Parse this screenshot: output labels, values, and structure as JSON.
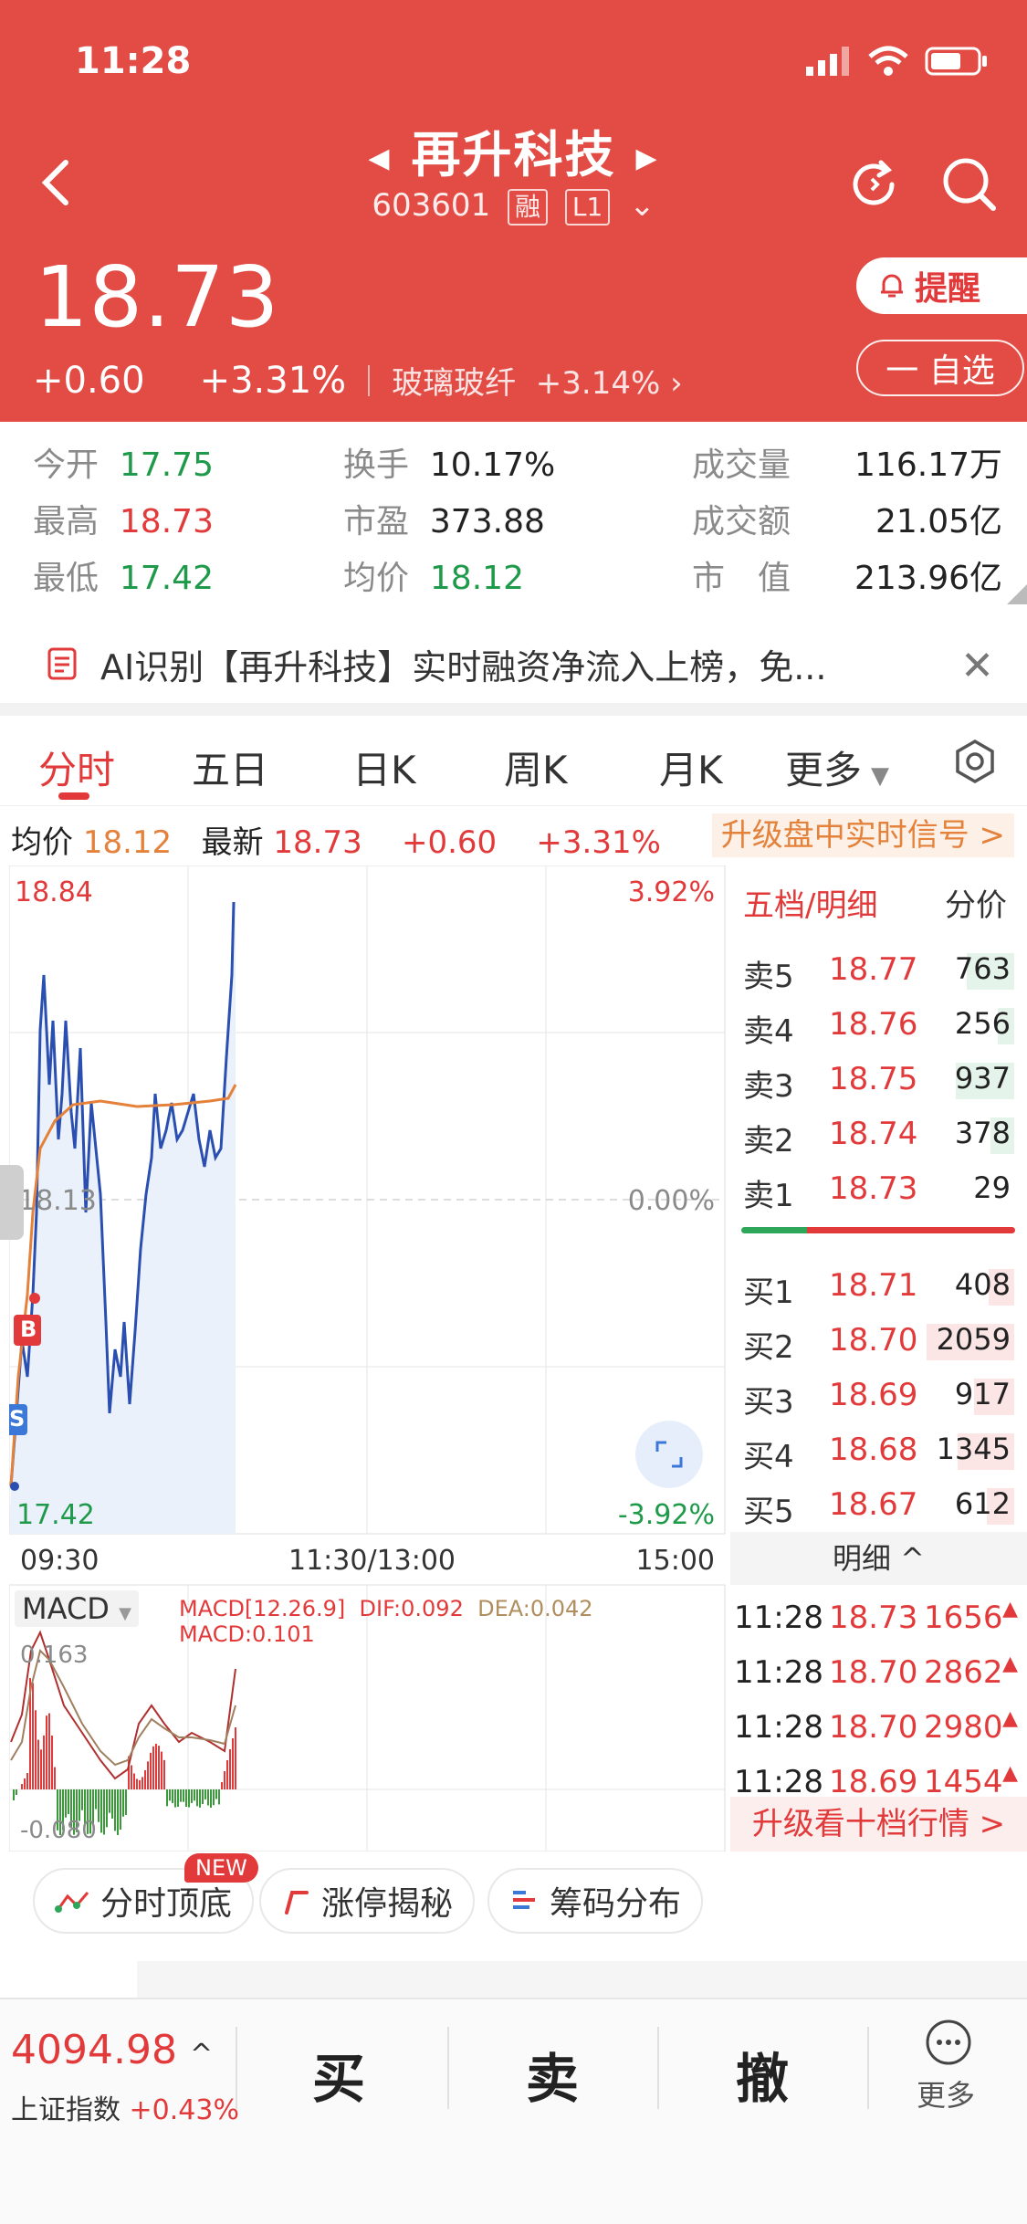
{
  "status": {
    "time": "11:28"
  },
  "stock": {
    "name": "再升科技",
    "code": "603601",
    "tag1": "融",
    "tag2": "L1",
    "price": "18.73",
    "change": "+0.60",
    "change_pct": "+3.31%",
    "industry": "玻璃玻纤",
    "industry_pct": "+3.14%"
  },
  "buttons": {
    "alert": "提醒",
    "watch": "一 自选"
  },
  "stats": [
    {
      "k": "今开",
      "v": "17.75"
    },
    {
      "k": "最高",
      "v": "18.73"
    },
    {
      "k": "最低",
      "v": "17.42"
    },
    {
      "k": "换手",
      "v": "10.17%"
    },
    {
      "k": "市盈",
      "v": "373.88"
    },
    {
      "k": "均价",
      "v": "18.12"
    },
    {
      "k": "成交量",
      "v": "116.17万"
    },
    {
      "k": "成交额",
      "v": "21.05亿"
    },
    {
      "k": "市　值",
      "v": "213.96亿"
    }
  ],
  "news": {
    "text": "AI识别【再升科技】实时融资净流入上榜，免..."
  },
  "tabs": [
    "分时",
    "五日",
    "日K",
    "周K",
    "月K",
    "更多"
  ],
  "infoline": {
    "avg_label": "均价",
    "avg": "18.12",
    "last_label": "最新",
    "last": "18.73",
    "chg": "+0.60",
    "pct": "+3.31%",
    "upgrade": "升级盘中实时信号 >"
  },
  "chart": {
    "max": "18.84",
    "max_pct": "3.92%",
    "mid": "18.13",
    "mid_pct": "0.00%",
    "min": "17.42",
    "min_pct": "-3.92%",
    "marker_b": "B",
    "marker_s": "S",
    "times": [
      "09:30",
      "11:30/13:00",
      "15:00"
    ],
    "macd_label": "MACD",
    "macd_params": "MACD[12.26.9]",
    "dif": "DIF:0.092",
    "dea": "DEA:0.042",
    "macd_val": "MACD:0.101",
    "macd_max": "0.163",
    "macd_min": "-0.080"
  },
  "orderbook": {
    "title": "五档/明细",
    "right": "分价",
    "asks": [
      {
        "l": "卖5",
        "p": "18.77",
        "v": "763"
      },
      {
        "l": "卖4",
        "p": "18.76",
        "v": "256"
      },
      {
        "l": "卖3",
        "p": "18.75",
        "v": "937"
      },
      {
        "l": "卖2",
        "p": "18.74",
        "v": "378"
      },
      {
        "l": "卖1",
        "p": "18.73",
        "v": "29"
      }
    ],
    "bids": [
      {
        "l": "买1",
        "p": "18.71",
        "v": "408"
      },
      {
        "l": "买2",
        "p": "18.70",
        "v": "2059"
      },
      {
        "l": "买3",
        "p": "18.69",
        "v": "917"
      },
      {
        "l": "买4",
        "p": "18.68",
        "v": "1345"
      },
      {
        "l": "买5",
        "p": "18.67",
        "v": "612"
      }
    ],
    "detail_title": "明细 ^",
    "ticks": [
      {
        "t": "11:28",
        "p": "18.73",
        "v": "1656"
      },
      {
        "t": "11:28",
        "p": "18.70",
        "v": "2862"
      },
      {
        "t": "11:28",
        "p": "18.70",
        "v": "2980"
      },
      {
        "t": "11:28",
        "p": "18.69",
        "v": "1454"
      }
    ],
    "upgrade10": "升级看十档行情 >"
  },
  "chips": [
    "分时顶底",
    "涨停揭秘",
    "筹码分布"
  ],
  "new_badge": "NEW",
  "bottom": {
    "index_value": "4094.98",
    "index_name": "上证指数",
    "index_pct": "+0.43%",
    "buy": "买",
    "sell": "卖",
    "cancel": "撤",
    "more": "更多"
  }
}
